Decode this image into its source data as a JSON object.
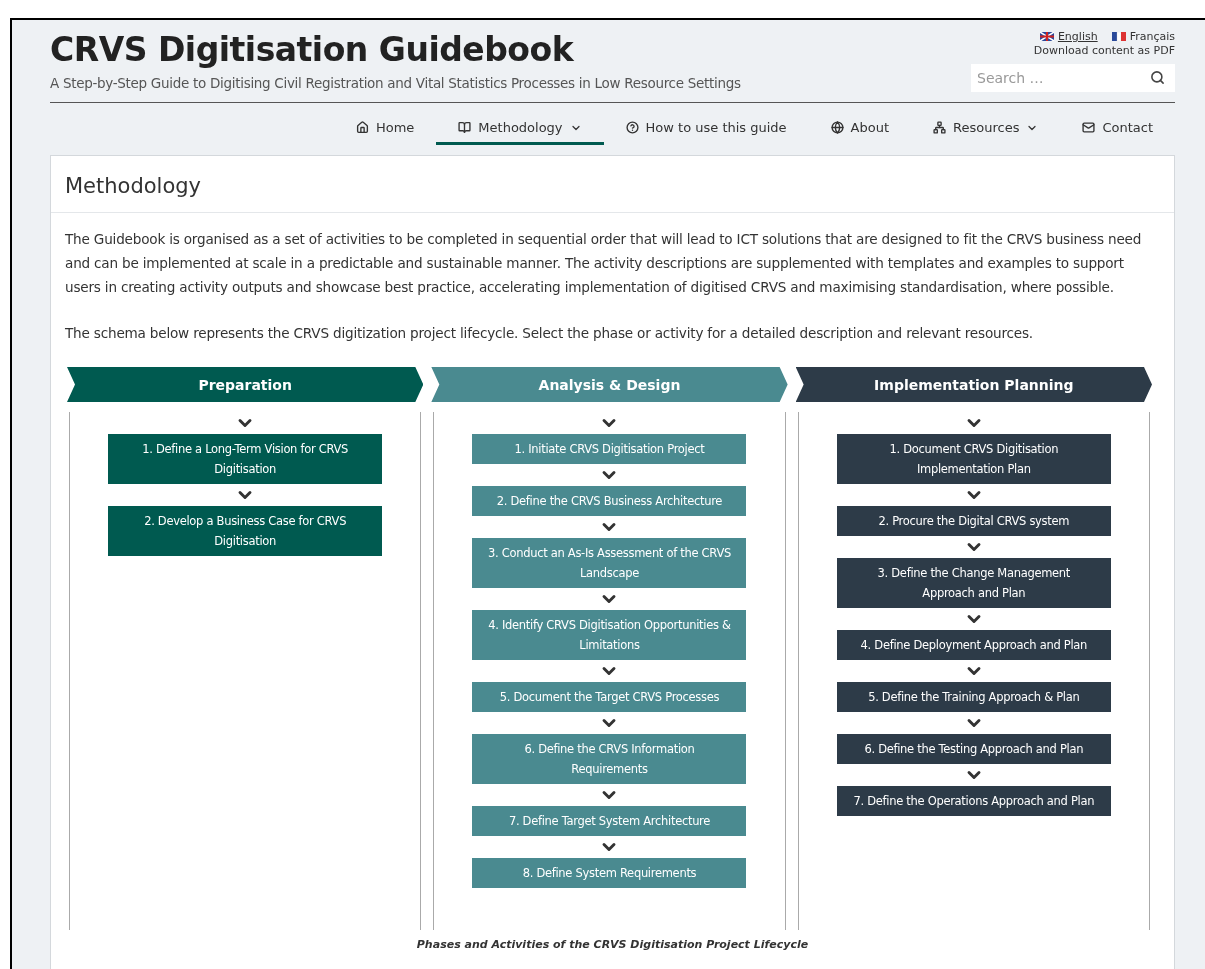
{
  "header": {
    "title": "CRVS Digitisation Guidebook",
    "subtitle": "A Step-by-Step Guide to Digitising Civil Registration and Vital Statistics Processes in Low Resource Settings",
    "languages": [
      {
        "label": "English",
        "selected": true
      },
      {
        "label": "Français",
        "selected": false
      }
    ],
    "download_link": "Download content as PDF",
    "search": {
      "placeholder": "Search …"
    }
  },
  "nav": [
    {
      "label": "Home",
      "selected": false,
      "has_menu": false
    },
    {
      "label": "Methodology",
      "selected": true,
      "has_menu": true
    },
    {
      "label": "How to use this guide",
      "selected": false,
      "has_menu": false
    },
    {
      "label": "About",
      "selected": false,
      "has_menu": false
    },
    {
      "label": "Resources",
      "selected": false,
      "has_menu": true
    },
    {
      "label": "Contact",
      "selected": false,
      "has_menu": false
    }
  ],
  "page": {
    "title": "Methodology",
    "paragraphs": [
      "The Guidebook is organised as a set of activities to be completed in sequential order that will lead to ICT solutions that are designed to fit the CRVS business need and can be implemented at scale in a predictable and sustainable manner. The activity descriptions are supplemented with templates and examples to support users in creating activity outputs and showcase best practice, accelerating implementation of digitised CRVS and maximising standardisation, where possible.",
      "The schema below represents the CRVS digitization project lifecycle. Select the phase or activity for a detailed description and relevant resources."
    ],
    "phases": [
      {
        "title": "Preparation",
        "color": "#005a50",
        "activities": [
          "1. Define a Long-Term Vision for CRVS Digitisation",
          "2. Develop a Business Case for CRVS Digitisation"
        ]
      },
      {
        "title": "Analysis & Design",
        "color": "#4a8a90",
        "activities": [
          "1. Initiate CRVS Digitisation Project",
          "2. Define the CRVS Business Architecture",
          "3. Conduct an As-Is Assessment of the CRVS Landscape",
          "4. Identify CRVS Digitisation Opportunities & Limitations",
          "5. Document the Target CRVS Processes",
          "6. Define the CRVS Information Requirements",
          "7. Define Target System Architecture",
          "8. Define System Requirements"
        ]
      },
      {
        "title": "Implementation Planning",
        "color": "#2d3b48",
        "activities": [
          "1. Document CRVS Digitisation Implementation Plan",
          "2. Procure the Digital CRVS system",
          "3. Define the Change Management Approach and Plan",
          "4. Define Deployment Approach and Plan",
          "5. Define the Training Approach & Plan",
          "6. Define the Testing Approach and Plan",
          "7. Define the Operations Approach and Plan"
        ]
      }
    ],
    "caption": "Phases and Activities of the CRVS Digitisation Project Lifecycle"
  }
}
